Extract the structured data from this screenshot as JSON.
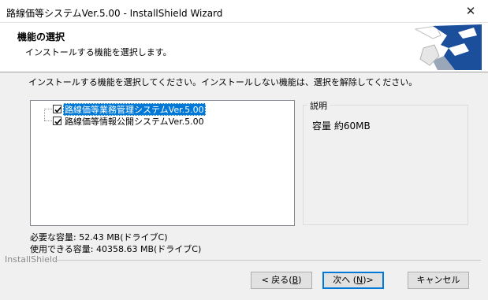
{
  "window": {
    "title": "路線価等システムVer.5.00 - InstallShield Wizard",
    "close_glyph": "✕"
  },
  "header": {
    "title": "機能の選択",
    "subtitle": "インストールする機能を選択します。"
  },
  "instructions": "インストールする機能を選択してください。インストールしない機能は、選択を解除してください。",
  "features": [
    {
      "label": "路線価等業務管理システムVer.5.00",
      "checked": true,
      "selected": true
    },
    {
      "label": "路線価等情報公開システムVer.5.00",
      "checked": true,
      "selected": false
    }
  ],
  "description": {
    "legend": "説明",
    "text": "容量 約60MB"
  },
  "space": {
    "required": "必要な容量: 52.43 MB(ドライブC)",
    "available": "使用できる容量: 40358.63 MB(ドライブC)"
  },
  "footer": {
    "brand": "InstallShield"
  },
  "buttons": {
    "back": {
      "prefix": "< 戻る(",
      "key": "B",
      "suffix": ")"
    },
    "next": {
      "prefix": "次へ (",
      "key": "N",
      "suffix": ")>"
    },
    "cancel": "キャンセル"
  },
  "colors": {
    "selection": "#0078d7",
    "logo": "#1b4f9c"
  }
}
